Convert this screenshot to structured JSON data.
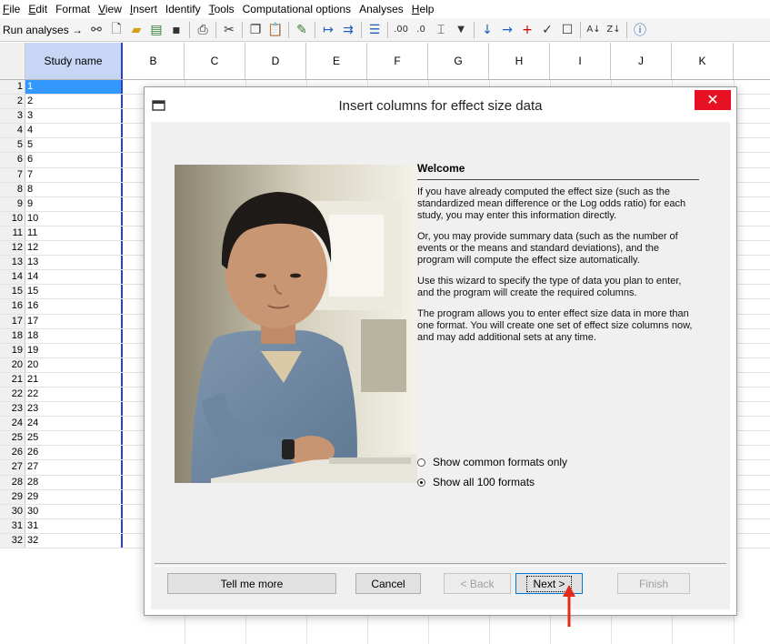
{
  "menubar": {
    "items": [
      {
        "label": "File",
        "key": "F"
      },
      {
        "label": "Edit",
        "key": "E"
      },
      {
        "label": "Format",
        "key": ""
      },
      {
        "label": "View",
        "key": "V"
      },
      {
        "label": "Insert",
        "key": "I"
      },
      {
        "label": "Identify",
        "key": ""
      },
      {
        "label": "Tools",
        "key": "T"
      },
      {
        "label": "Computational options",
        "key": ""
      },
      {
        "label": "Analyses",
        "key": ""
      },
      {
        "label": "Help",
        "key": "H"
      }
    ]
  },
  "toolbar": {
    "run_analyses_label": "Run analyses →",
    "icons": [
      "link-icon",
      "new-file-icon",
      "open-folder-icon",
      "open-file-icon",
      "save-icon",
      "print-icon",
      "cut-icon",
      "copy-icon",
      "paste-icon",
      "edit-icon",
      "move-left-icon",
      "move-right-icon",
      "list-icon",
      "decimal-increase-icon",
      "decimal-decrease-icon",
      "columns-icon",
      "dropdown-icon",
      "arrow-down-icon",
      "arrow-right-icon",
      "plus-icon",
      "check-icon",
      "checkbox-icon",
      "sort-ascending-icon",
      "sort-descending-icon",
      "info-icon"
    ]
  },
  "grid": {
    "columns": [
      "Study name",
      "B",
      "C",
      "D",
      "E",
      "F",
      "G",
      "H",
      "I",
      "J",
      "K"
    ],
    "rows": [
      {
        "num": "1",
        "name": "1"
      },
      {
        "num": "2",
        "name": "2"
      },
      {
        "num": "3",
        "name": "3"
      },
      {
        "num": "4",
        "name": "4"
      },
      {
        "num": "5",
        "name": "5"
      },
      {
        "num": "6",
        "name": "6"
      },
      {
        "num": "7",
        "name": "7"
      },
      {
        "num": "8",
        "name": "8"
      },
      {
        "num": "9",
        "name": "9"
      },
      {
        "num": "10",
        "name": "10"
      },
      {
        "num": "11",
        "name": "11"
      },
      {
        "num": "12",
        "name": "12"
      },
      {
        "num": "13",
        "name": "13"
      },
      {
        "num": "14",
        "name": "14"
      },
      {
        "num": "15",
        "name": "15"
      },
      {
        "num": "16",
        "name": "16"
      },
      {
        "num": "17",
        "name": "17"
      },
      {
        "num": "18",
        "name": "18"
      },
      {
        "num": "19",
        "name": "19"
      },
      {
        "num": "20",
        "name": "20"
      },
      {
        "num": "21",
        "name": "21"
      },
      {
        "num": "22",
        "name": "22"
      },
      {
        "num": "23",
        "name": "23"
      },
      {
        "num": "24",
        "name": "24"
      },
      {
        "num": "25",
        "name": "25"
      },
      {
        "num": "26",
        "name": "26"
      },
      {
        "num": "27",
        "name": "27"
      },
      {
        "num": "28",
        "name": "28"
      },
      {
        "num": "29",
        "name": "29"
      },
      {
        "num": "30",
        "name": "30"
      },
      {
        "num": "31",
        "name": "31"
      },
      {
        "num": "32",
        "name": "32"
      }
    ],
    "selected_row": "1"
  },
  "dialog": {
    "title": "Insert columns for effect size data",
    "close_glyph": "✕",
    "welcome_title": "Welcome",
    "paragraphs": [
      "If you have already computed the effect size (such as the standardized mean difference or the Log odds ratio) for each study, you may enter this information directly.",
      "Or, you may provide summary data (such as the number of events or the means and standard deviations), and the program will compute the effect size automatically.",
      "Use this wizard to specify the type of data you plan to enter, and the program will create the required columns.",
      "The program allows you to enter effect size data in more than one format.  You will create one set of effect size columns now, and may add additional sets at any time."
    ],
    "radio_common": "Show common formats only",
    "radio_all": "Show all 100 formats",
    "radio_selected": "all",
    "buttons": {
      "tell_me_more": "Tell me more",
      "cancel": "Cancel",
      "back": "< Back",
      "next": "Next >",
      "finish": "Finish"
    }
  },
  "colors": {
    "selection": "#3399ff",
    "study_name_header": "#c8d6f5",
    "close_button": "#e81123",
    "pointer_arrow": "#e32b1a"
  }
}
